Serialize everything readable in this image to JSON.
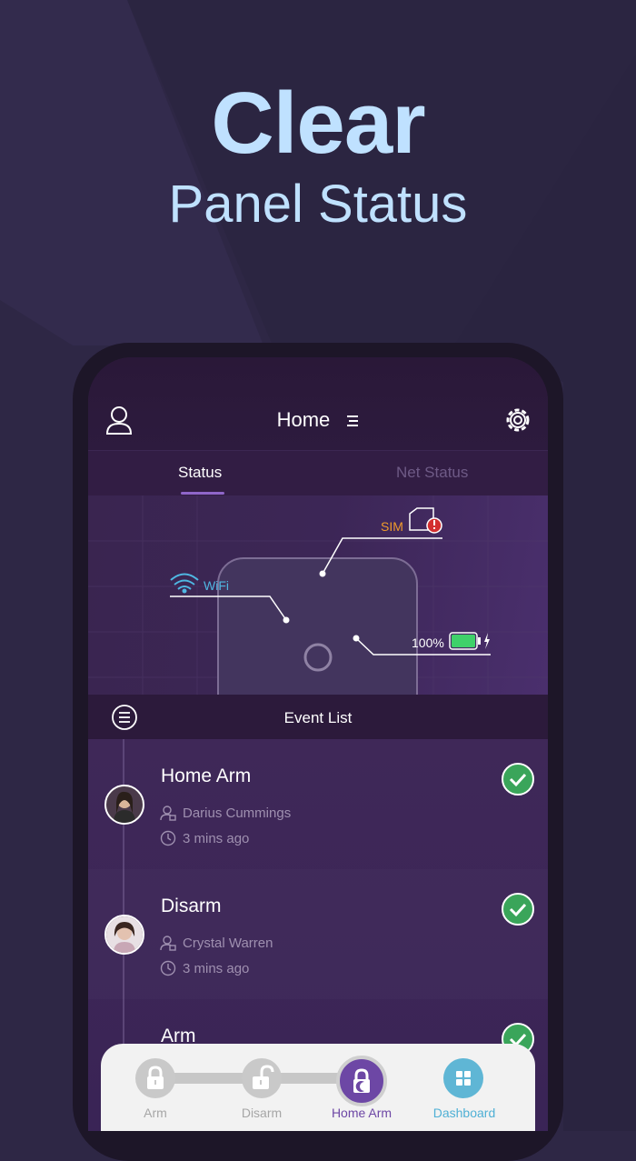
{
  "hero": {
    "title": "Clear",
    "subtitle": "Panel Status"
  },
  "topbar": {
    "title": "Home"
  },
  "tabs": [
    {
      "label": "Status"
    },
    {
      "label": "Net Status"
    }
  ],
  "diagram": {
    "sim_label": "SIM",
    "wifi_label": "WiFi",
    "battery_label": "100%"
  },
  "event_list": {
    "title": "Event List",
    "events": [
      {
        "name": "Home Arm",
        "user": "Darius Cummings",
        "time": "3 mins ago"
      },
      {
        "name": "Disarm",
        "user": "Crystal Warren",
        "time": "3 mins ago"
      },
      {
        "name": "Arm"
      }
    ]
  },
  "bottom_nav": [
    {
      "label": "Arm"
    },
    {
      "label": "Disarm"
    },
    {
      "label": "Home Arm"
    },
    {
      "label": "Dashboard"
    }
  ],
  "colors": {
    "background": "#2e2745",
    "hero_text": "#bfe1ff",
    "accent": "#6d47a5",
    "sim_warning": "#ee9a2c",
    "wifi": "#4fb7e2",
    "battery": "#3fd16a",
    "check": "#3aa55a",
    "dashboard": "#5fb6d5"
  }
}
